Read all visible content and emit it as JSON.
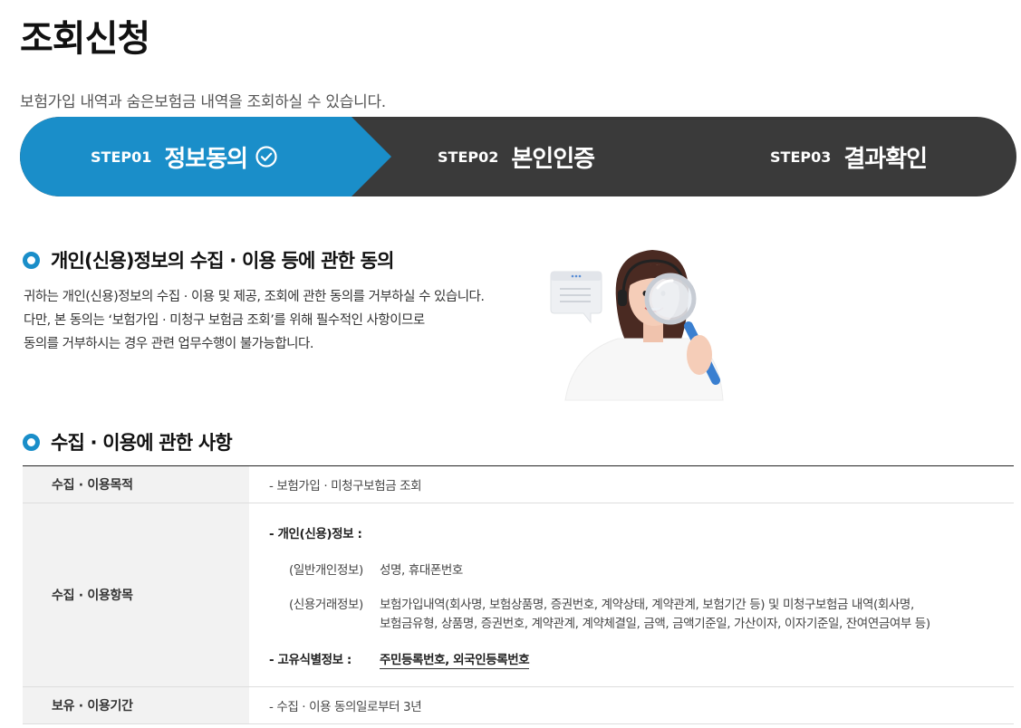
{
  "page": {
    "title": "조회신청",
    "description": "보험가입 내역과 숨은보험금 내역을 조회하실 수 있습니다."
  },
  "steps": [
    {
      "num": "STEP01",
      "name": "정보동의"
    },
    {
      "num": "STEP02",
      "name": "본인인증"
    },
    {
      "num": "STEP03",
      "name": "결과확인"
    }
  ],
  "colors": {
    "active_step": "#1a8ec9",
    "inactive_step": "#3a3a3a",
    "bullet": "#1a8ec9"
  },
  "consent": {
    "heading": "개인(신용)정보의 수집 · 이용 등에 관한 동의",
    "lines": [
      "귀하는 개인(신용)정보의 수집 · 이용 및 제공, 조회에 관한 동의를 거부하실 수 있습니다.",
      "다만, 본 동의는 ‘보험가입 · 미청구 보험금 조회’를 위해 필수적인 사항이므로",
      "동의를 거부하시는 경우 관련 업무수행이 불가능합니다."
    ]
  },
  "usage": {
    "heading": "수집 · 이용에 관한 사항",
    "purpose": {
      "label": "수집 · 이용목적",
      "value": "- 보험가입 · 미청구보험금 조회"
    },
    "items": {
      "label": "수집 · 이용항목",
      "personal_title": "- 개인(신용)정보 :",
      "general_label": "(일반개인정보)",
      "general_value": "성명, 휴대폰번호",
      "credit_label": "(신용거래정보)",
      "credit_value_1": "보험가입내역(회사명, 보험상품명, 증권번호, 계약상태, 계약관계, 보험기간 등) 및 미청구보험금 내역(회사명,",
      "credit_value_2": "보험금유형, 상품명, 증권번호, 계약관계, 계약체결일, 금액, 금액기준일, 가산이자, 이자기준일, 잔여연금여부 등)",
      "unique_title": "- 고유식별정보 :",
      "unique_value": "주민등록번호, 외국인등록번호"
    },
    "retention": {
      "label": "보유 · 이용기간",
      "value": "- 수집 · 이용 동의일로부터 3년"
    }
  }
}
